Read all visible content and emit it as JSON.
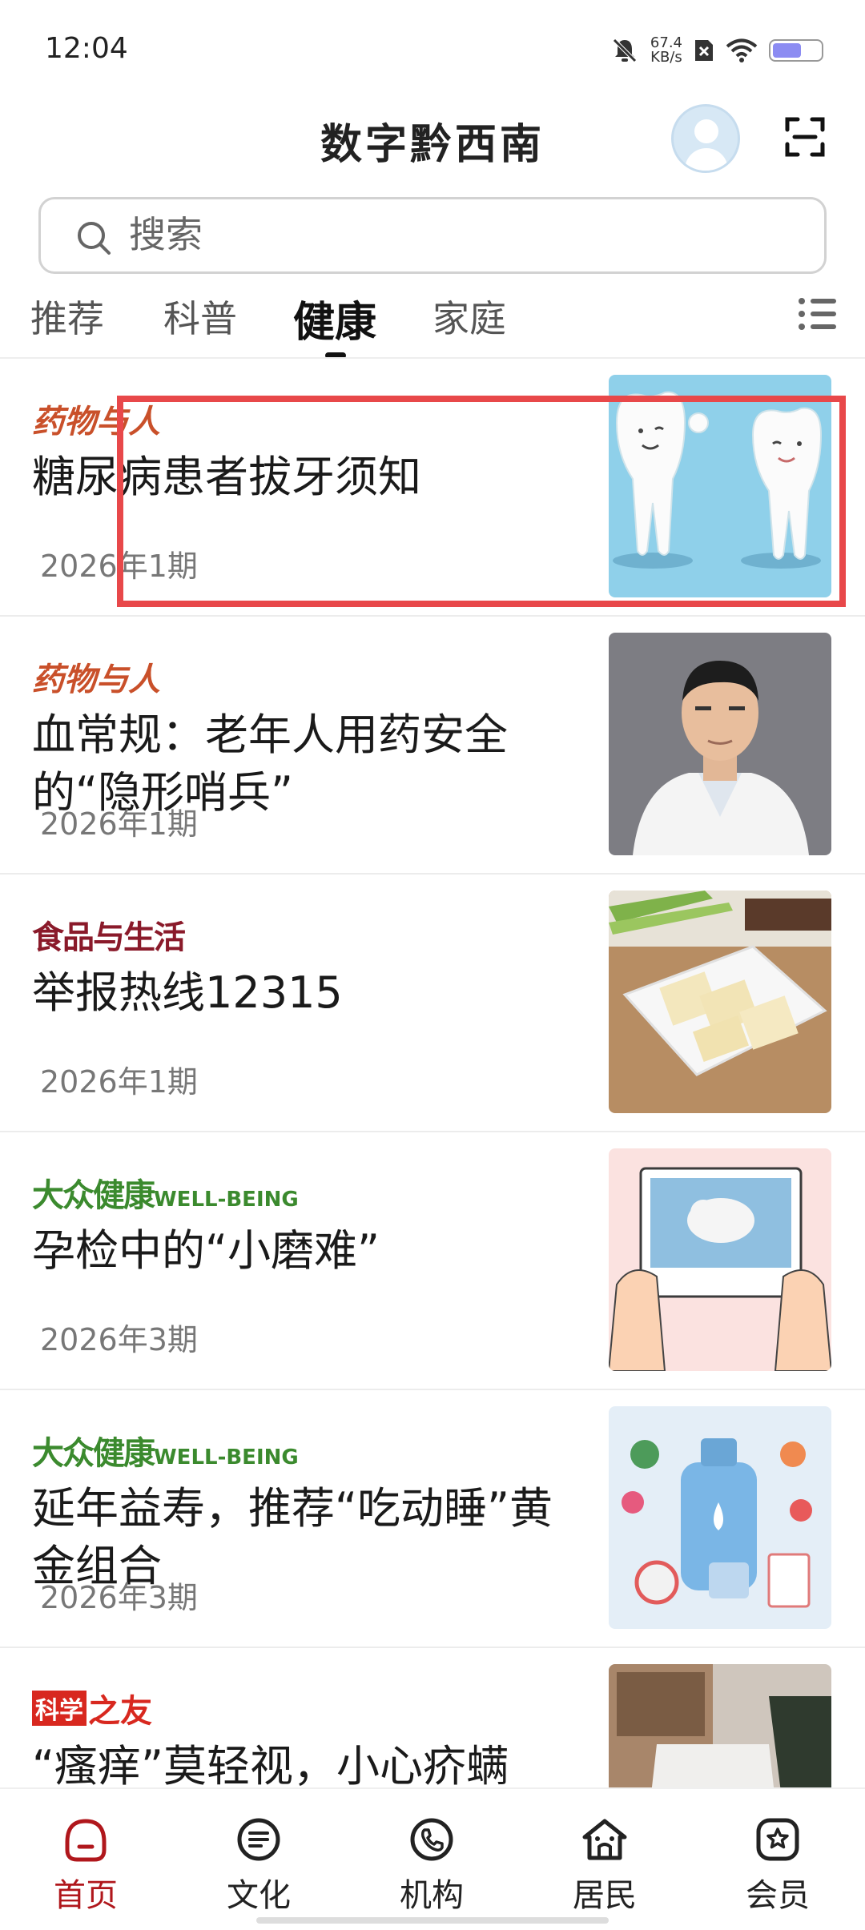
{
  "status_bar": {
    "time": "12:04",
    "net_speed_value": "67.4",
    "net_speed_unit": "KB/s",
    "battery_level": 0.6
  },
  "header": {
    "title": "数字黔西南"
  },
  "search": {
    "placeholder": "搜索"
  },
  "tabs": [
    {
      "label": "推荐"
    },
    {
      "label": "科普"
    },
    {
      "label": "健康",
      "active": true
    },
    {
      "label": "家庭"
    }
  ],
  "articles": [
    {
      "source": "药物与人",
      "title": "糖尿病患者拔牙须知",
      "issue": "2026年1期",
      "thumb": "teeth-cartoon"
    },
    {
      "source": "药物与人",
      "title": "血常规：老年人用药安全的“隐形哨兵”",
      "issue": "2026年1期",
      "thumb": "doctor-portrait"
    },
    {
      "source": "食品与生活",
      "title": "举报热线12315",
      "issue": "2026年1期",
      "thumb": "tofu-plate"
    },
    {
      "source_main": "大众健康",
      "source_sub": "WELL-BEING",
      "title": "孕检中的“小磨难”",
      "issue": "2026年3期",
      "thumb": "ultrasound-illustration"
    },
    {
      "source_main": "大众健康",
      "source_sub": "WELL-BEING",
      "title": "延年益寿，推荐“吃动睡”黄金组合",
      "issue": "2026年3期",
      "thumb": "health-illustration"
    },
    {
      "source_box": "科学",
      "source_rest": "之友",
      "title": "“瘙痒”莫轻视，小心疥螨",
      "issue": "",
      "thumb": "vacuum-photo"
    }
  ],
  "bottom_nav": [
    {
      "label": "首页",
      "icon": "home-icon",
      "active": true
    },
    {
      "label": "文化",
      "icon": "culture-icon"
    },
    {
      "label": "机构",
      "icon": "phone-icon"
    },
    {
      "label": "居民",
      "icon": "residents-icon"
    },
    {
      "label": "会员",
      "icon": "member-icon"
    }
  ],
  "colors": {
    "accent": "#b0171c",
    "highlight": "#e8484a",
    "source_yaowu": "#c9502a",
    "source_dazhong": "#3b8a2e"
  }
}
